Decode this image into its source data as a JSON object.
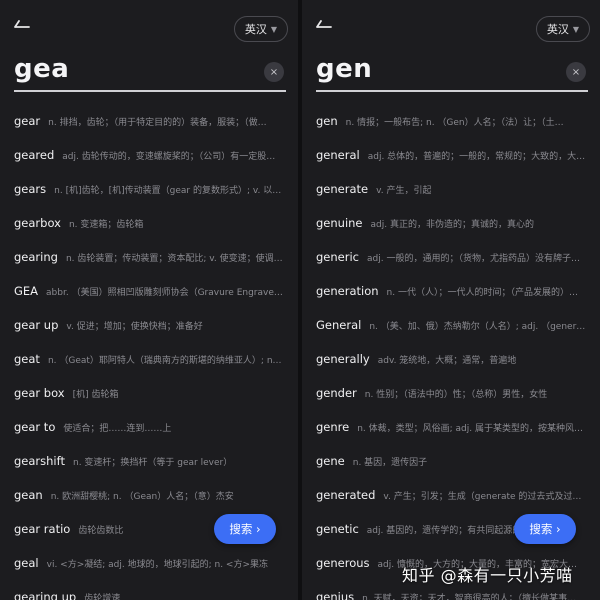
{
  "left": {
    "lang_label": "英汉",
    "query": "gea",
    "clear_icon": "×",
    "search_button": "搜索 ›",
    "results": [
      {
        "word": "gear",
        "def": "n. 排挡，齿轮；（用于特定目的的）装备，服装；（做…"
      },
      {
        "word": "geared",
        "def": "adj. 齿轮传动的，变速螺旋桨的；（公司）有一定股…"
      },
      {
        "word": "gears",
        "def": "n. [机]齿轮，[机]传动装置（gear 的复数形式）; v. 以…"
      },
      {
        "word": "gearbox",
        "def": "n. 变速箱；齿轮箱"
      },
      {
        "word": "gearing",
        "def": "n. 齿轮装置；传动装置；资本配比; v. 使变速；使调…"
      },
      {
        "word": "GEA",
        "def": "abbr. （美国）照相凹版雕刻师协会（Gravure Engraver…"
      },
      {
        "word": "gear up",
        "def": "v. 促进；增加；使换快档；准备好"
      },
      {
        "word": "geat",
        "def": "n. （Geat）耶阿特人（瑞典南方的斯堪的纳维亚人）; n…"
      },
      {
        "word": "gear box",
        "def": "[机] 齿轮箱"
      },
      {
        "word": "gear to",
        "def": "使适合；把……连到……上"
      },
      {
        "word": "gearshift",
        "def": "n. 变速杆；换挡杆（等于 gear lever）"
      },
      {
        "word": "gean",
        "def": "n. 欧洲甜樱桃; n. （Gean）人名；（意）杰安"
      },
      {
        "word": "gear ratio",
        "def": "齿轮齿数比"
      },
      {
        "word": "geal",
        "def": "vi. <方>凝结; adj. 地球的，地球引起的; n. <方>果冻"
      },
      {
        "word": "gearing up",
        "def": "齿轮增速"
      }
    ]
  },
  "right": {
    "lang_label": "英汉",
    "query": "gen",
    "clear_icon": "×",
    "search_button": "搜索 ›",
    "results": [
      {
        "word": "gen",
        "def": "n. 情报；一般布告; n. （Gen）人名；（法）让；（土…"
      },
      {
        "word": "general",
        "def": "adj. 总体的，普遍的；一般的，常规的；大致的，大…"
      },
      {
        "word": "generate",
        "def": "v. 产生，引起"
      },
      {
        "word": "genuine",
        "def": "adj. 真正的，非伪造的；真诚的，真心的"
      },
      {
        "word": "generic",
        "def": "adj. 一般的，通用的；（货物，尤指药品）没有牌子…"
      },
      {
        "word": "generation",
        "def": "n. 一代（人）；一代人的时间；（产品发展的）…"
      },
      {
        "word": "General",
        "def": "n. （美、加、俄）杰纳勒尔（人名）; adj. （gener…"
      },
      {
        "word": "generally",
        "def": "adv. 笼统地，大概；通常，普遍地"
      },
      {
        "word": "gender",
        "def": "n. 性别；（语法中的）性；（总称）男性，女性"
      },
      {
        "word": "genre",
        "def": "n. 体裁，类型；风俗画; adj. 属于某类型的，按某种风…"
      },
      {
        "word": "gene",
        "def": "n. 基因，遗传因子"
      },
      {
        "word": "generated",
        "def": "v. 产生；引发；生成（generate 的过去式及过…"
      },
      {
        "word": "genetic",
        "def": "adj. 基因的，遗传学的；有共同起源的…"
      },
      {
        "word": "generous",
        "def": "adj. 慷慨的，大方的；大量的，丰富的；宽宏大…"
      },
      {
        "word": "genius",
        "def": "n. 天赋，天资；天才，智商很高的人；（擅长做某事…"
      }
    ]
  },
  "watermark": "知乎 @森有一只小芳喵",
  "colors": {
    "accent": "#3c6ef5",
    "background": "#1c1c1f"
  },
  "icons": {
    "back": "back-arrow-icon",
    "clear": "clear-icon",
    "dropdown": "chevron-down-icon"
  }
}
